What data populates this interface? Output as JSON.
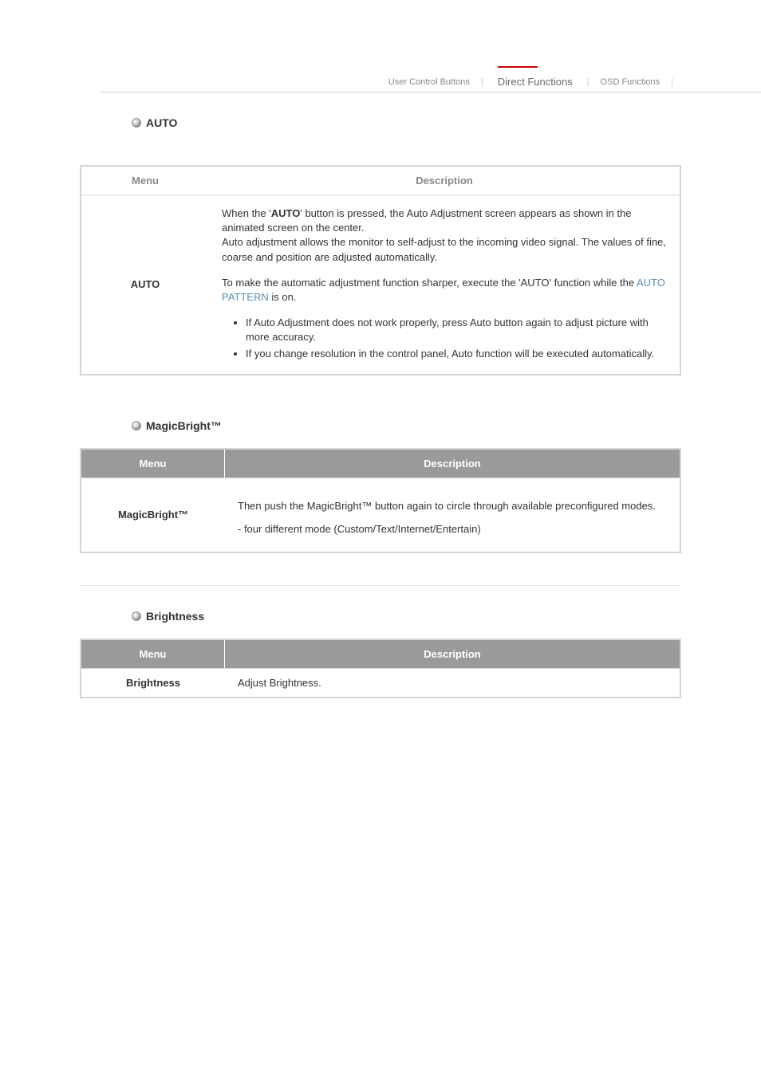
{
  "nav": {
    "user_control": "User Control Buttons",
    "direct_functions": "Direct Functions",
    "osd_functions": "OSD Functions"
  },
  "sections": {
    "auto": {
      "title": "AUTO",
      "menu_header": "Menu",
      "desc_header": "Description",
      "menu_label": "AUTO",
      "desc_p1_prefix": "When the '",
      "desc_p1_bold": "AUTO",
      "desc_p1_suffix": "' button is pressed, the Auto Adjustment screen appears as shown in the animated screen on the center.",
      "desc_p1_line2": "Auto adjustment allows the monitor to self-adjust to the incoming video signal. The values of fine, coarse and position are adjusted automatically.",
      "desc_p2_prefix": "To make the automatic adjustment function sharper, execute the 'AUTO' function while the ",
      "desc_p2_link": "AUTO PATTERN",
      "desc_p2_suffix": " is on.",
      "bullet1": "If Auto Adjustment does not work properly, press Auto button again to adjust picture with more accuracy.",
      "bullet2": "If you change resolution in the control panel, Auto function will be executed automatically."
    },
    "magicbright": {
      "title": "MagicBright™",
      "menu_header": "Menu",
      "desc_header": "Description",
      "menu_label": "MagicBright™",
      "desc_line1": "Then push the MagicBright™ button again to circle through available preconfigured modes.",
      "desc_line2": "- four different mode (Custom/Text/Internet/Entertain)"
    },
    "brightness": {
      "title": "Brightness",
      "menu_header": "Menu",
      "desc_header": "Description",
      "menu_label": "Brightness",
      "desc": "Adjust Brightness."
    }
  }
}
